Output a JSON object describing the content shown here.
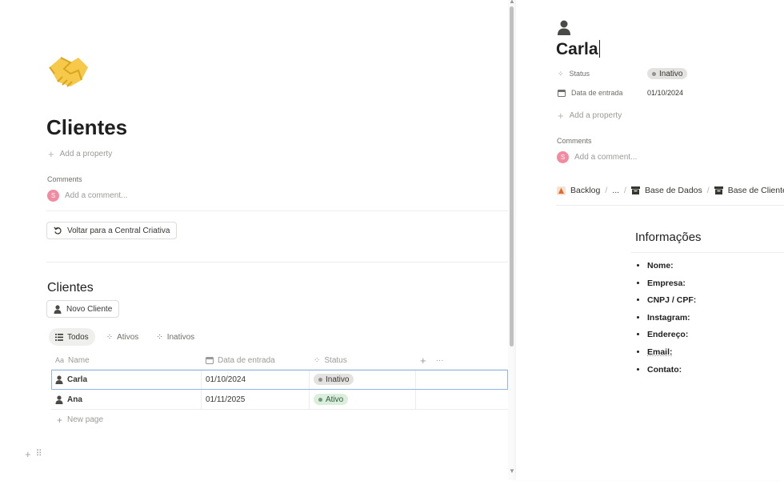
{
  "page": {
    "title": "Clientes",
    "add_property": "Add a property",
    "comments_label": "Comments",
    "comment_placeholder": "Add a comment...",
    "avatar_letter": "S",
    "back_button": "Voltar para a Central Criativa"
  },
  "database": {
    "title": "Clientes",
    "new_button": "Novo Cliente",
    "views": [
      {
        "label": "Todos",
        "active": true
      },
      {
        "label": "Ativos",
        "active": false
      },
      {
        "label": "Inativos",
        "active": false
      }
    ],
    "columns": [
      "Name",
      "Data de entrada",
      "Status"
    ],
    "rows": [
      {
        "name": "Carla",
        "date": "01/10/2024",
        "status": "Inativo"
      },
      {
        "name": "Ana",
        "date": "01/11/2025",
        "status": "Ativo"
      }
    ],
    "new_page": "New page",
    "more": "···",
    "status_colors": {
      "Inativo": "#e3e2e0",
      "Ativo": "#dbeddb"
    },
    "status_dot_colors": {
      "Inativo": "#91918e",
      "Ativo": "#6c9b7d"
    }
  },
  "peek": {
    "title": "Carla",
    "properties": [
      {
        "label": "Status",
        "value": "Inativo"
      },
      {
        "label": "Data de entrada",
        "value": "01/10/2024"
      }
    ],
    "add_property": "Add a property",
    "comments_label": "Comments",
    "comment_placeholder": "Add a comment...",
    "avatar_letter": "S",
    "breadcrumb": [
      "Backlog",
      "...",
      "Base de Dados",
      "Base de Clientes"
    ],
    "info_heading": "Informações",
    "info_items": [
      "Nome:",
      "Empresa:",
      "CNPJ / CPF:",
      "Instagram:",
      "Endereço:",
      "Email:",
      "Contato:"
    ]
  }
}
